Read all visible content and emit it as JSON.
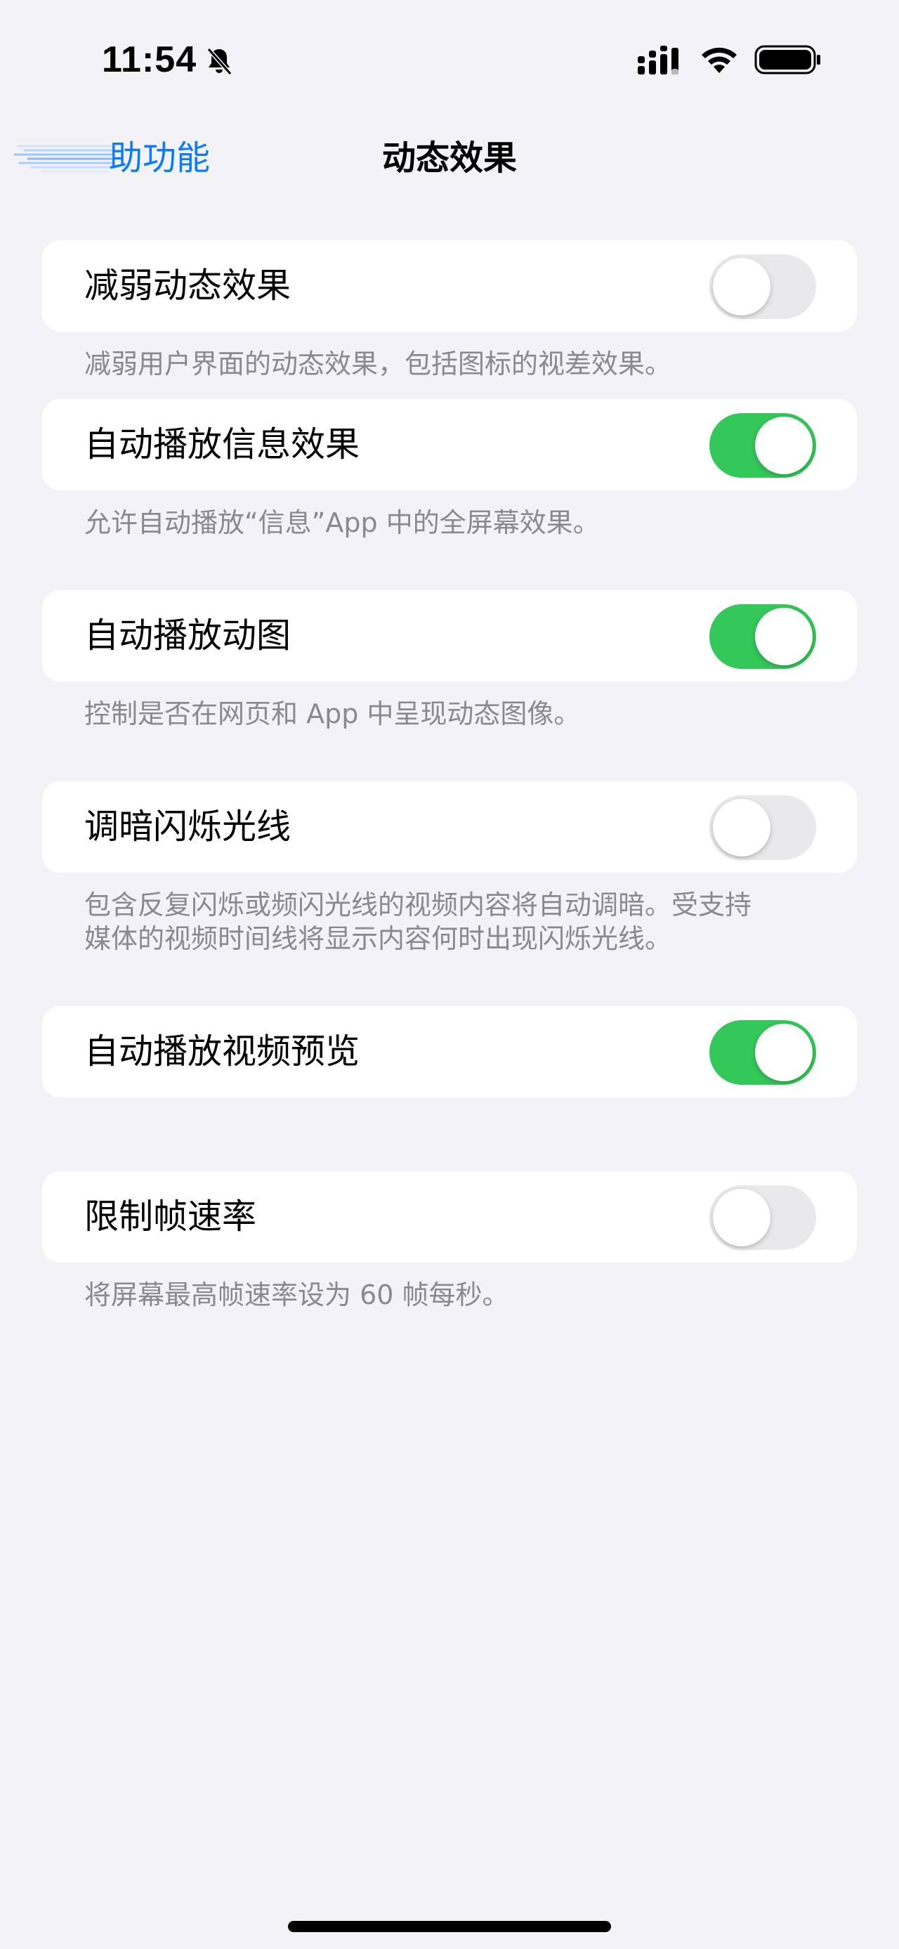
{
  "status_bar": {
    "time": "11:54",
    "icons": [
      "bell-slash-icon",
      "cellular-signal-icon",
      "wifi-icon",
      "battery-icon"
    ]
  },
  "nav": {
    "back_label": "助功能",
    "title": "动态效果"
  },
  "groups": [
    {
      "label": "减弱动态效果",
      "toggle_on": false,
      "footer": "减弱用户界面的动态效果，包括图标的视差效果。"
    },
    {
      "label": "自动播放信息效果",
      "toggle_on": true,
      "footer": "允许自动播放“信息”App 中的全屏幕效果。"
    },
    {
      "label": "自动播放动图",
      "toggle_on": true,
      "footer": "控制是否在网页和 App 中呈现动态图像。"
    },
    {
      "label": "调暗闪烁光线",
      "toggle_on": false,
      "footer_line1": "包含反复闪烁或频闪光线的视频内容将自动调暗。受支持",
      "footer_line2": "媒体的视频时间线将显示内容何时出现闪烁光线。"
    },
    {
      "label": "自动播放视频预览",
      "toggle_on": true
    },
    {
      "label": "限制帧速率",
      "toggle_on": false,
      "footer": "将屏幕最高帧速率设为 60 帧每秒。"
    }
  ],
  "colors": {
    "background": "#f2f2f7",
    "card": "#ffffff",
    "accent": "#0a7aff",
    "toggle_on": "#34c759",
    "toggle_off": "#e9e9eb",
    "footer_text": "#8a8a8e"
  }
}
